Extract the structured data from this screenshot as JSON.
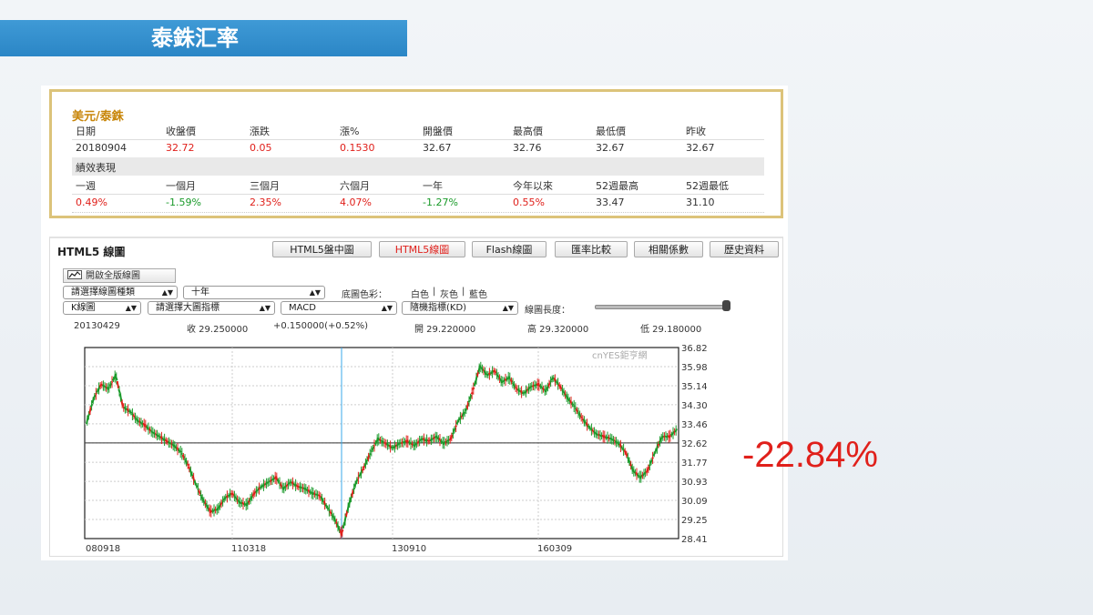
{
  "slide": {
    "title": "泰銖汇率",
    "big_change": "-22.84%"
  },
  "quote": {
    "title": "美元/泰銖",
    "headers": [
      "日期",
      "收盤價",
      "漲跌",
      "漲%",
      "開盤價",
      "最高價",
      "最低價",
      "昨收"
    ],
    "values": [
      "20180904",
      "32.72",
      "0.05",
      "0.1530",
      "32.67",
      "32.76",
      "32.67",
      "32.67"
    ],
    "section": "績效表現",
    "perf_headers": [
      "一週",
      "一個月",
      "三個月",
      "六個月",
      "一年",
      "今年以來",
      "52週最高",
      "52週最低"
    ],
    "perf_values": [
      "0.49%",
      "-1.59%",
      "2.35%",
      "4.07%",
      "-1.27%",
      "0.55%",
      "33.47",
      "31.10"
    ],
    "colors": {
      "up": "#e0201b",
      "down": "#1a9a2a",
      "title": "#c8860a"
    }
  },
  "chart_panel": {
    "title": "HTML5 線圖",
    "tabs": [
      "HTML5盤中圖",
      "HTML5線圖",
      "Flash線圖",
      "匯率比較",
      "相關係數",
      "歷史資料"
    ],
    "active_tab": "HTML5線圖",
    "full_button": "開啟全版線圖",
    "selects": {
      "chart_type": "請選擇線圖種類",
      "period": "十年",
      "kline": "K線圖",
      "main_indicator": "請選擇大圖指標",
      "macd": "MACD",
      "random": "隨機指標(KD)"
    },
    "bg_color_label": "底圖色彩：",
    "bg_colors": [
      "白色",
      "灰色",
      "藍色"
    ],
    "length_label": "線圖長度：",
    "info": {
      "date": "20130429",
      "close": "收 29.250000",
      "change": "+0.150000(+0.52%)",
      "open": "開 29.220000",
      "high": "高 29.320000",
      "low": "低 29.180000"
    },
    "watermark": "cnYES鉅亨網"
  },
  "chart_data": {
    "type": "line",
    "title": "",
    "xlabel": "",
    "ylabel": "",
    "x_ticks": [
      "080918",
      "110318",
      "130910",
      "160309"
    ],
    "y_ticks": [
      36.82,
      35.98,
      35.14,
      34.3,
      33.46,
      32.62,
      31.77,
      30.93,
      30.09,
      29.25,
      28.41
    ],
    "ylim": [
      28.41,
      36.82
    ],
    "reference_line": 32.62,
    "series": [
      {
        "values": [
          33.5,
          34.6,
          35.2,
          35.0,
          35.6,
          34.2,
          34.0,
          33.6,
          33.4,
          33.1,
          32.9,
          32.7,
          32.5,
          32.2,
          31.6,
          30.8,
          30.1,
          29.6,
          29.7,
          30.2,
          30.4,
          30.0,
          29.9,
          30.4,
          30.7,
          30.9,
          31.1,
          30.6,
          30.9,
          30.7,
          30.6,
          30.4,
          30.3,
          29.8,
          29.3,
          28.6,
          29.9,
          30.9,
          31.5,
          32.2,
          32.8,
          32.6,
          32.4,
          32.6,
          32.7,
          32.5,
          32.8,
          32.7,
          32.9,
          32.6,
          32.8,
          33.6,
          34.0,
          34.9,
          36.0,
          35.6,
          35.8,
          35.3,
          35.5,
          35.0,
          34.8,
          35.1,
          35.2,
          34.9,
          35.5,
          35.1,
          34.6,
          34.2,
          33.7,
          33.3,
          33.0,
          32.9,
          32.8,
          32.6,
          32.2,
          31.4,
          31.1,
          31.4,
          32.2,
          32.9,
          32.9,
          33.2
        ]
      }
    ],
    "colors": {
      "up": "#e0201b",
      "down": "#1a9a2a",
      "cursor": "#39a9e8",
      "frame": "#222222"
    },
    "grid": true
  }
}
